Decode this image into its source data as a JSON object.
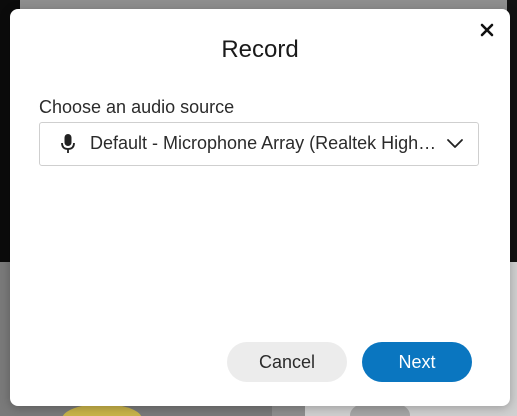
{
  "dialog": {
    "title": "Record",
    "close_icon": "close-icon"
  },
  "audio_source": {
    "label": "Choose an audio source",
    "selected": "Default - Microphone Array (Realtek High Definition Audio)",
    "icon": "microphone-icon",
    "dropdown_icon": "chevron-down-icon"
  },
  "footer": {
    "cancel_label": "Cancel",
    "next_label": "Next"
  },
  "colors": {
    "primary": "#0a76c0",
    "secondary_button": "#ececec",
    "text": "#2b2b2b"
  }
}
